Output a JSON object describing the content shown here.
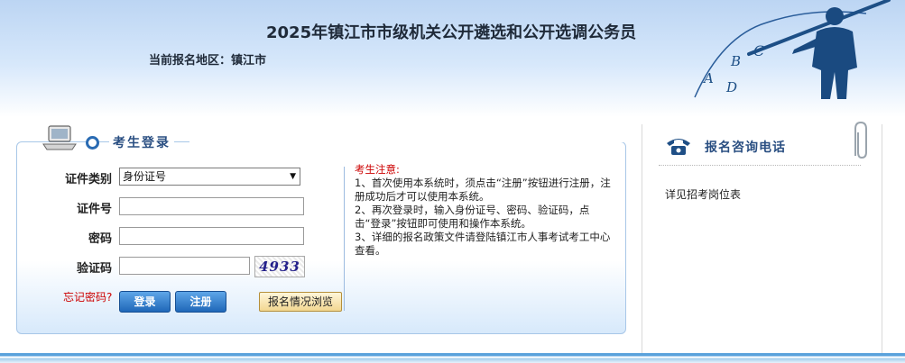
{
  "header": {
    "title": "2025年镇江市市级机关公开遴选和公开选调公务员",
    "region_label": "当前报名地区：镇江市"
  },
  "login": {
    "title": "考生登录",
    "fields": {
      "id_type_label": "证件类别",
      "id_type_value": "身份证号",
      "id_number_label": "证件号",
      "password_label": "密码",
      "captcha_label": "验证码",
      "captcha_value": "4933"
    },
    "forgot_password": "忘记密码?",
    "login_button": "登录",
    "register_button": "注册",
    "browse_button": "报名情况浏览"
  },
  "notice": {
    "title": "考生注意:",
    "items": [
      "1、首次使用本系统时，须点击“注册”按钮进行注册，注册成功后才可以使用本系统。",
      "2、再次登录时，输入身份证号、密码、验证码，点击“登录”按钮即可使用和操作本系统。",
      "3、详细的报名政策文件请登陆镇江市人事考试考工中心查看。"
    ]
  },
  "consult": {
    "title": "报名咨询电话",
    "link": "详见招考岗位表"
  },
  "decor": {
    "letters": [
      "A",
      "B",
      "C",
      "D"
    ],
    "icons": [
      "laptop-icon",
      "phone-icon",
      "paperclip-icon",
      "teacher-figure"
    ]
  },
  "colors": {
    "accent": "#2a4f82",
    "button_blue": "#1f67b8",
    "notice_red": "#cc0000"
  }
}
